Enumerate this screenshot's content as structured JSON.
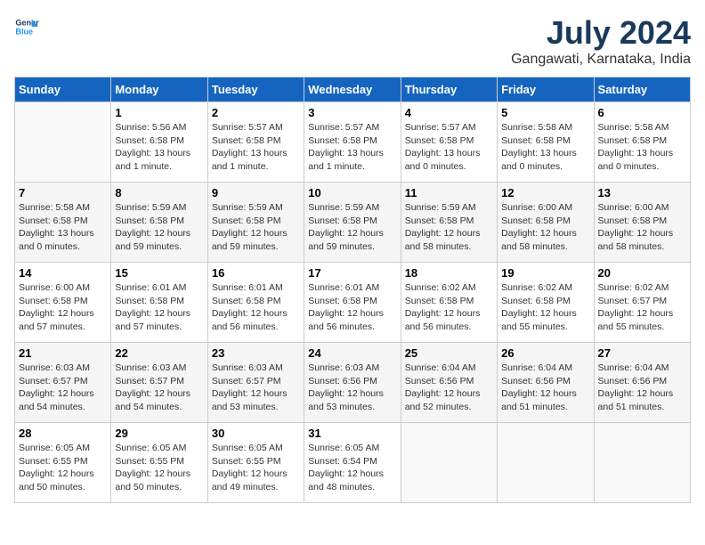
{
  "header": {
    "logo_line1": "General",
    "logo_line2": "Blue",
    "month": "July 2024",
    "location": "Gangawati, Karnataka, India"
  },
  "days_of_week": [
    "Sunday",
    "Monday",
    "Tuesday",
    "Wednesday",
    "Thursday",
    "Friday",
    "Saturday"
  ],
  "weeks": [
    [
      {
        "day": "",
        "info": ""
      },
      {
        "day": "1",
        "info": "Sunrise: 5:56 AM\nSunset: 6:58 PM\nDaylight: 13 hours\nand 1 minute."
      },
      {
        "day": "2",
        "info": "Sunrise: 5:57 AM\nSunset: 6:58 PM\nDaylight: 13 hours\nand 1 minute."
      },
      {
        "day": "3",
        "info": "Sunrise: 5:57 AM\nSunset: 6:58 PM\nDaylight: 13 hours\nand 1 minute."
      },
      {
        "day": "4",
        "info": "Sunrise: 5:57 AM\nSunset: 6:58 PM\nDaylight: 13 hours\nand 0 minutes."
      },
      {
        "day": "5",
        "info": "Sunrise: 5:58 AM\nSunset: 6:58 PM\nDaylight: 13 hours\nand 0 minutes."
      },
      {
        "day": "6",
        "info": "Sunrise: 5:58 AM\nSunset: 6:58 PM\nDaylight: 13 hours\nand 0 minutes."
      }
    ],
    [
      {
        "day": "7",
        "info": "Sunrise: 5:58 AM\nSunset: 6:58 PM\nDaylight: 13 hours\nand 0 minutes."
      },
      {
        "day": "8",
        "info": "Sunrise: 5:59 AM\nSunset: 6:58 PM\nDaylight: 12 hours\nand 59 minutes."
      },
      {
        "day": "9",
        "info": "Sunrise: 5:59 AM\nSunset: 6:58 PM\nDaylight: 12 hours\nand 59 minutes."
      },
      {
        "day": "10",
        "info": "Sunrise: 5:59 AM\nSunset: 6:58 PM\nDaylight: 12 hours\nand 59 minutes."
      },
      {
        "day": "11",
        "info": "Sunrise: 5:59 AM\nSunset: 6:58 PM\nDaylight: 12 hours\nand 58 minutes."
      },
      {
        "day": "12",
        "info": "Sunrise: 6:00 AM\nSunset: 6:58 PM\nDaylight: 12 hours\nand 58 minutes."
      },
      {
        "day": "13",
        "info": "Sunrise: 6:00 AM\nSunset: 6:58 PM\nDaylight: 12 hours\nand 58 minutes."
      }
    ],
    [
      {
        "day": "14",
        "info": "Sunrise: 6:00 AM\nSunset: 6:58 PM\nDaylight: 12 hours\nand 57 minutes."
      },
      {
        "day": "15",
        "info": "Sunrise: 6:01 AM\nSunset: 6:58 PM\nDaylight: 12 hours\nand 57 minutes."
      },
      {
        "day": "16",
        "info": "Sunrise: 6:01 AM\nSunset: 6:58 PM\nDaylight: 12 hours\nand 56 minutes."
      },
      {
        "day": "17",
        "info": "Sunrise: 6:01 AM\nSunset: 6:58 PM\nDaylight: 12 hours\nand 56 minutes."
      },
      {
        "day": "18",
        "info": "Sunrise: 6:02 AM\nSunset: 6:58 PM\nDaylight: 12 hours\nand 56 minutes."
      },
      {
        "day": "19",
        "info": "Sunrise: 6:02 AM\nSunset: 6:58 PM\nDaylight: 12 hours\nand 55 minutes."
      },
      {
        "day": "20",
        "info": "Sunrise: 6:02 AM\nSunset: 6:57 PM\nDaylight: 12 hours\nand 55 minutes."
      }
    ],
    [
      {
        "day": "21",
        "info": "Sunrise: 6:03 AM\nSunset: 6:57 PM\nDaylight: 12 hours\nand 54 minutes."
      },
      {
        "day": "22",
        "info": "Sunrise: 6:03 AM\nSunset: 6:57 PM\nDaylight: 12 hours\nand 54 minutes."
      },
      {
        "day": "23",
        "info": "Sunrise: 6:03 AM\nSunset: 6:57 PM\nDaylight: 12 hours\nand 53 minutes."
      },
      {
        "day": "24",
        "info": "Sunrise: 6:03 AM\nSunset: 6:56 PM\nDaylight: 12 hours\nand 53 minutes."
      },
      {
        "day": "25",
        "info": "Sunrise: 6:04 AM\nSunset: 6:56 PM\nDaylight: 12 hours\nand 52 minutes."
      },
      {
        "day": "26",
        "info": "Sunrise: 6:04 AM\nSunset: 6:56 PM\nDaylight: 12 hours\nand 51 minutes."
      },
      {
        "day": "27",
        "info": "Sunrise: 6:04 AM\nSunset: 6:56 PM\nDaylight: 12 hours\nand 51 minutes."
      }
    ],
    [
      {
        "day": "28",
        "info": "Sunrise: 6:05 AM\nSunset: 6:55 PM\nDaylight: 12 hours\nand 50 minutes."
      },
      {
        "day": "29",
        "info": "Sunrise: 6:05 AM\nSunset: 6:55 PM\nDaylight: 12 hours\nand 50 minutes."
      },
      {
        "day": "30",
        "info": "Sunrise: 6:05 AM\nSunset: 6:55 PM\nDaylight: 12 hours\nand 49 minutes."
      },
      {
        "day": "31",
        "info": "Sunrise: 6:05 AM\nSunset: 6:54 PM\nDaylight: 12 hours\nand 48 minutes."
      },
      {
        "day": "",
        "info": ""
      },
      {
        "day": "",
        "info": ""
      },
      {
        "day": "",
        "info": ""
      }
    ]
  ]
}
